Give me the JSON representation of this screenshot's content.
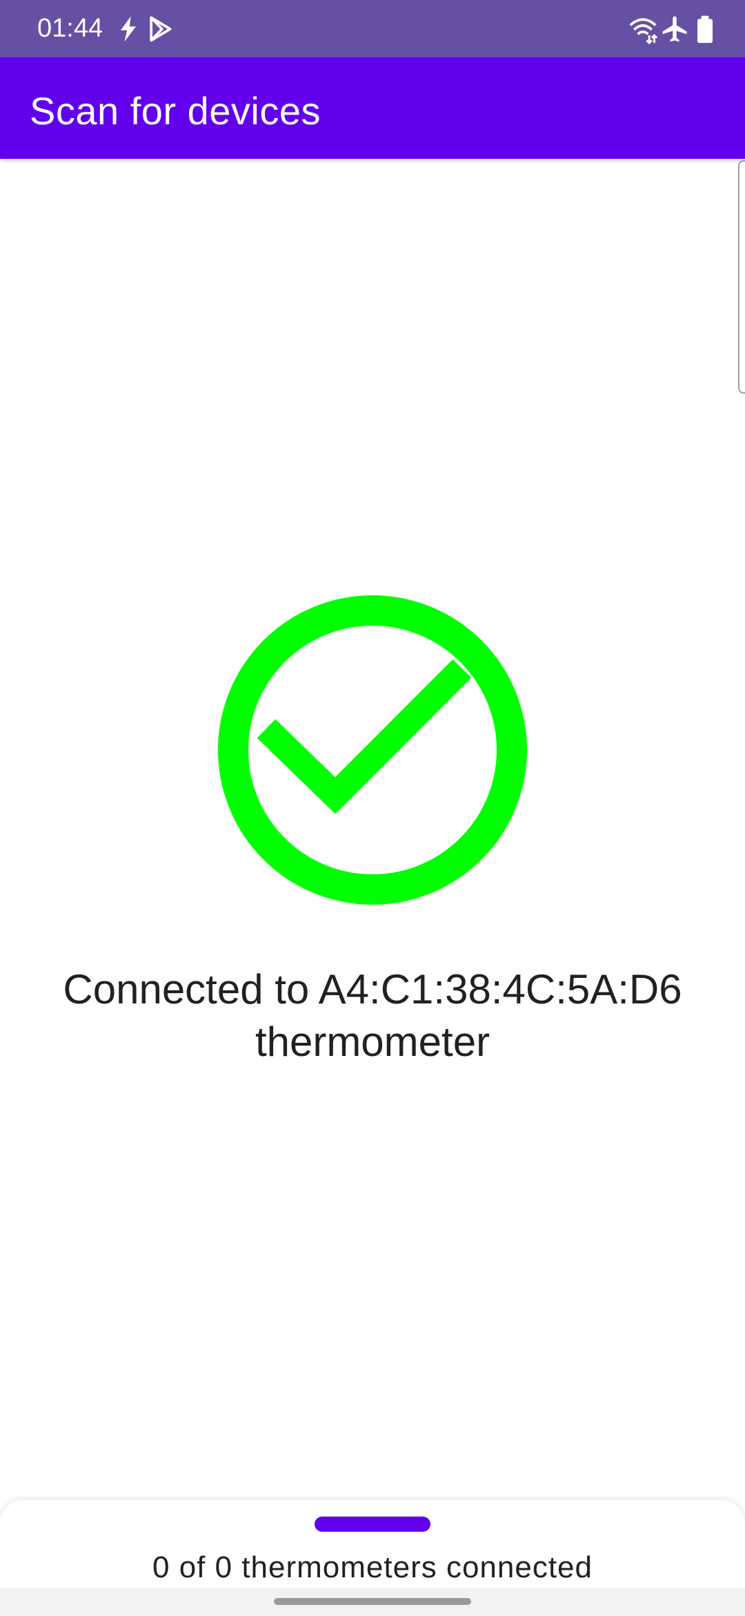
{
  "status_bar": {
    "time": "01:44",
    "icons": [
      "flash-icon",
      "play-store-icon",
      "wifi-icon",
      "airplane-icon",
      "battery-icon"
    ],
    "background_color": "#6650a4"
  },
  "app_bar": {
    "title": "Scan for devices",
    "background_color": "#6200ee"
  },
  "main": {
    "status_icon": "check-circle-icon",
    "status_icon_color": "#00ff00",
    "message_line1": "Connected to A4:C1:38:4C:5A:D6",
    "message_line2": "thermometer"
  },
  "bottom_sheet": {
    "summary": "0 of 0 thermometers connected",
    "handle_color": "#6200ee"
  }
}
